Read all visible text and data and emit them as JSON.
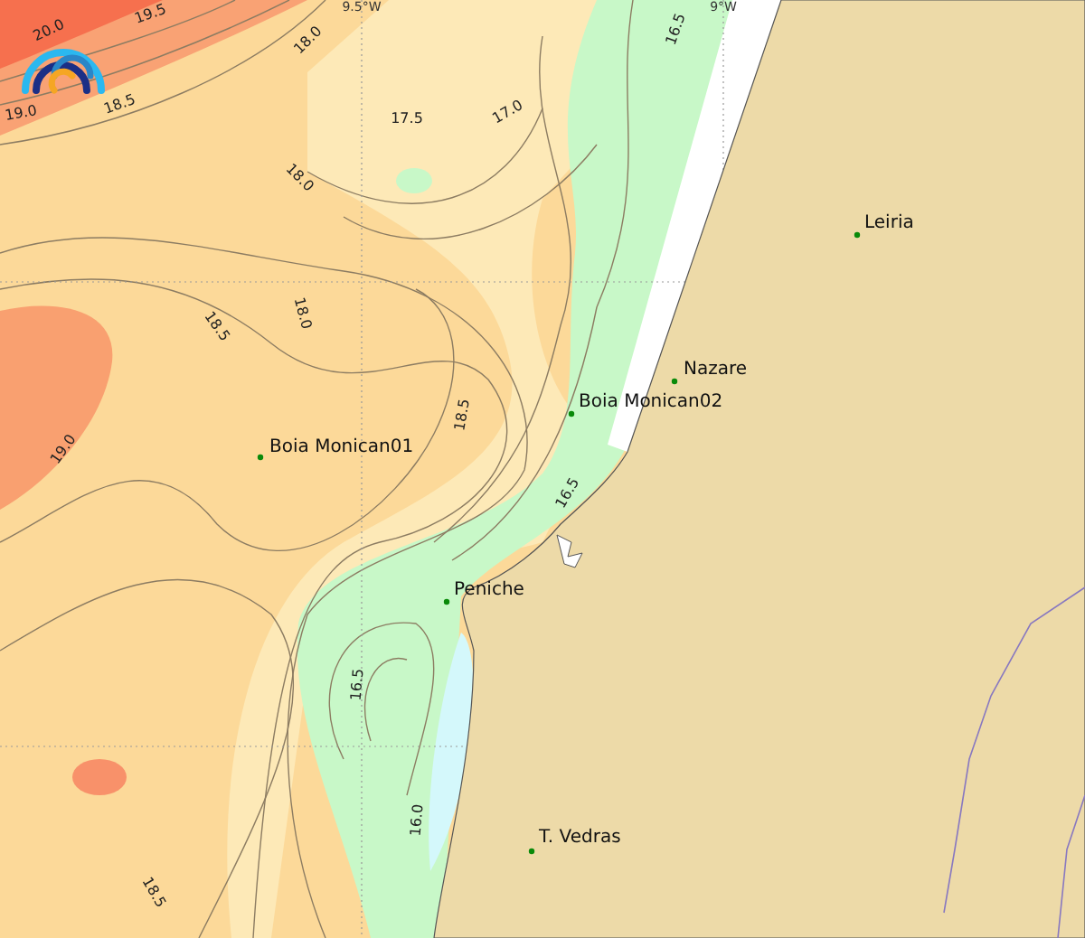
{
  "map": {
    "grid_labels": [
      {
        "text": "9.5°W"
      },
      {
        "text": "9°W"
      }
    ],
    "contour_labels": [
      {
        "text": "20.0"
      },
      {
        "text": "19.5"
      },
      {
        "text": "19.0"
      },
      {
        "text": "18.5"
      },
      {
        "text": "18.0"
      },
      {
        "text": "17.5"
      },
      {
        "text": "17.0"
      },
      {
        "text": "18.0"
      },
      {
        "text": "16.5"
      },
      {
        "text": "18.5"
      },
      {
        "text": "18.0"
      },
      {
        "text": "18.5"
      },
      {
        "text": "19.0"
      },
      {
        "text": "16.5"
      },
      {
        "text": "16.5"
      },
      {
        "text": "16.0"
      },
      {
        "text": "18.5"
      }
    ],
    "places": [
      {
        "name": "Leiria"
      },
      {
        "name": "Nazare"
      },
      {
        "name": "Boia Monican02"
      },
      {
        "name": "Boia Monican01"
      },
      {
        "name": "Peniche"
      },
      {
        "name": "T. Vedras"
      }
    ]
  }
}
